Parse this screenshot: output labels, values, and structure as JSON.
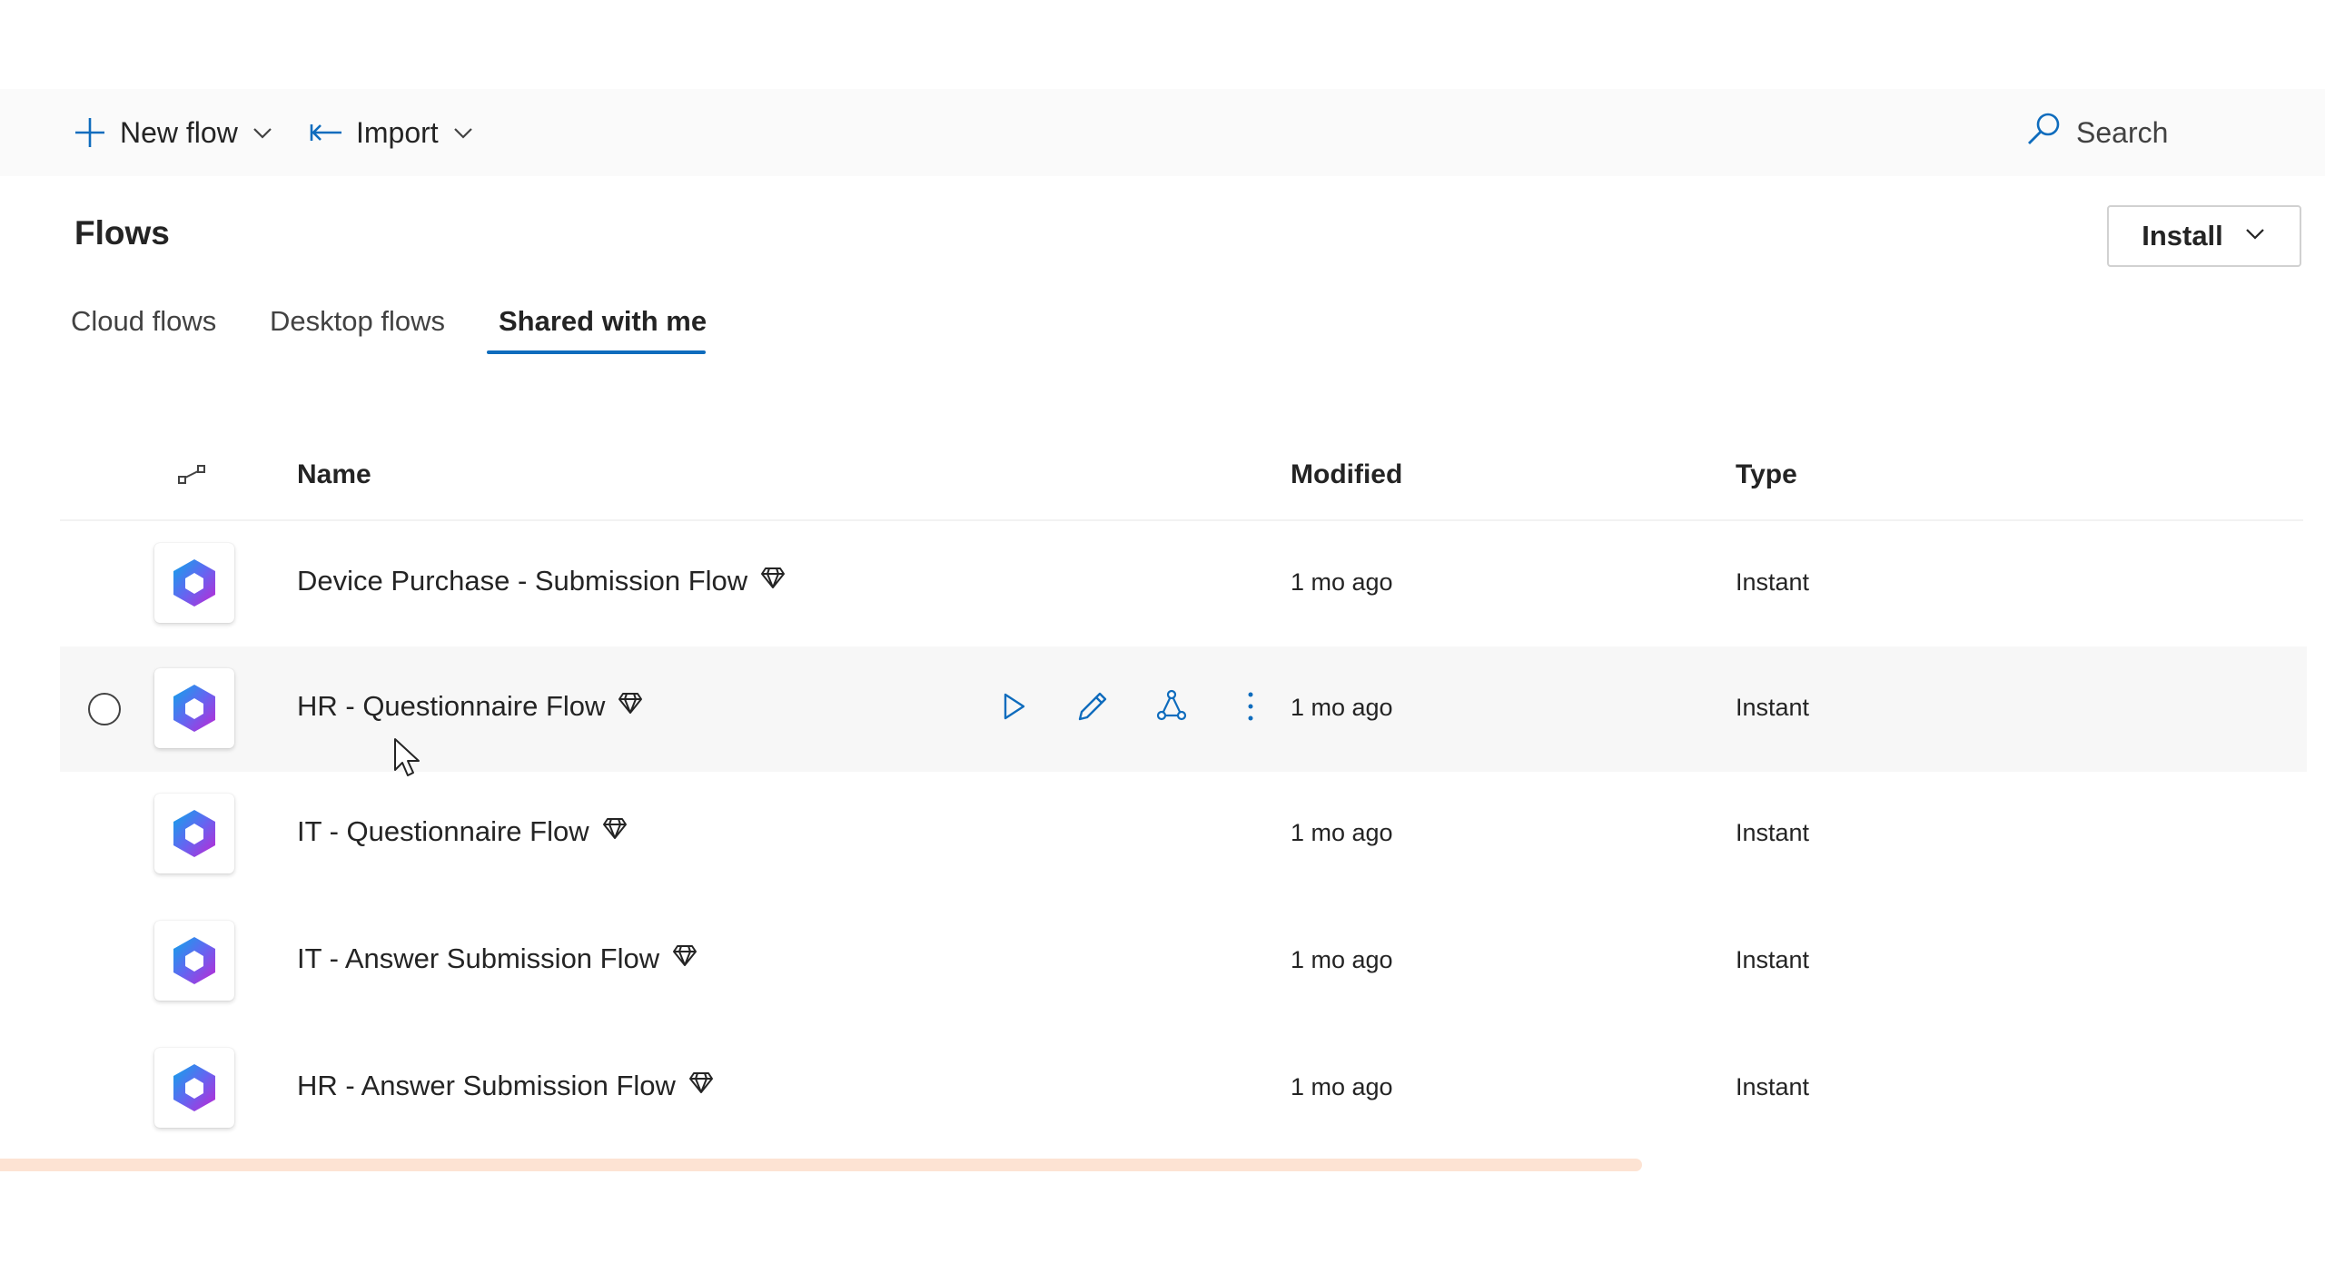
{
  "command_bar": {
    "new_flow_label": "New flow",
    "import_label": "Import",
    "search_placeholder": "Search"
  },
  "page": {
    "title": "Flows",
    "install_label": "Install"
  },
  "tabs": [
    {
      "label": "Cloud flows",
      "selected": false
    },
    {
      "label": "Desktop flows",
      "selected": false
    },
    {
      "label": "Shared with me",
      "selected": true
    }
  ],
  "table": {
    "columns": {
      "icon": "flow-type-icon",
      "name": "Name",
      "modified": "Modified",
      "type": "Type"
    },
    "rows": [
      {
        "name": "Device Purchase - Submission Flow",
        "modified": "1 mo ago",
        "type": "Instant",
        "premium": true
      },
      {
        "name": "HR - Questionnaire Flow",
        "modified": "1 mo ago",
        "type": "Instant",
        "premium": true,
        "hovered": true
      },
      {
        "name": "IT - Questionnaire Flow",
        "modified": "1 mo ago",
        "type": "Instant",
        "premium": true
      },
      {
        "name": "IT - Answer Submission Flow",
        "modified": "1 mo ago",
        "type": "Instant",
        "premium": true
      },
      {
        "name": "HR - Answer Submission Flow",
        "modified": "1 mo ago",
        "type": "Instant",
        "premium": true
      }
    ],
    "row_actions": [
      "play-icon",
      "edit-pencil-icon",
      "share-icon",
      "more-options-icon"
    ]
  },
  "colors": {
    "accent": "#0f6cbd",
    "text": "#242424",
    "command_bar_bg": "#fafafa",
    "hover_row_bg": "#f7f7f7",
    "scrollbar": "#fde3d3"
  }
}
